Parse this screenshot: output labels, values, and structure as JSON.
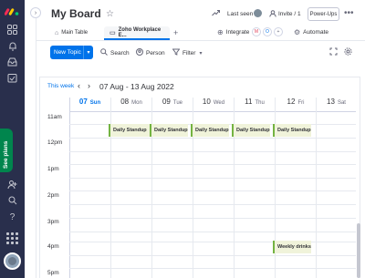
{
  "sidebar": {
    "logo": "monday-logo-icon",
    "icons": [
      "grid-icon",
      "bell-icon",
      "inbox-icon",
      "check-calendar-icon",
      "person-add-icon",
      "search-icon",
      "help-icon"
    ],
    "see_plans_label": "See plans"
  },
  "header": {
    "title": "My Board",
    "last_seen_label": "Last seen",
    "invite_label": "Invite / 1",
    "power_ups_label": "Power-Ups",
    "more": "•••"
  },
  "tabs": [
    {
      "label": "Main Table",
      "icon": "home-icon"
    },
    {
      "label": "Zoho Workplace E...",
      "icon": "app-icon",
      "active": true
    }
  ],
  "tab_add": "+",
  "integrate_label": "Integrate",
  "automate_label": "Automate",
  "toolbar": {
    "new_topic_label": "New Topic",
    "search_label": "Search",
    "person_label": "Person",
    "filter_label": "Filter"
  },
  "calendar": {
    "this_week_label": "This week",
    "range_label": "07 Aug - 13 Aug 2022",
    "days": [
      {
        "num": "07",
        "name": "Sun",
        "today": true
      },
      {
        "num": "08",
        "name": "Mon"
      },
      {
        "num": "09",
        "name": "Tue"
      },
      {
        "num": "10",
        "name": "Wed"
      },
      {
        "num": "11",
        "name": "Thu"
      },
      {
        "num": "12",
        "name": "Fri"
      },
      {
        "num": "13",
        "name": "Sat"
      }
    ],
    "times": [
      "11am",
      "12pm",
      "1pm",
      "2pm",
      "3pm",
      "4pm",
      "5pm"
    ],
    "events": [
      {
        "title": "Daily Standup",
        "day": "Mon"
      },
      {
        "title": "Daily Standup",
        "day": "Tue"
      },
      {
        "title": "Daily Standup",
        "day": "Wed"
      },
      {
        "title": "Daily Standup",
        "day": "Thu"
      },
      {
        "title": "Daily Standup",
        "day": "Fri"
      },
      {
        "title": "Weekly drinks",
        "day": "Fri"
      }
    ]
  },
  "colors": {
    "accent": "#0073ea",
    "sidebar": "#292f4c",
    "see_plans": "#00854d",
    "event_bg": "#f0f3da",
    "event_border": "#74b342"
  }
}
